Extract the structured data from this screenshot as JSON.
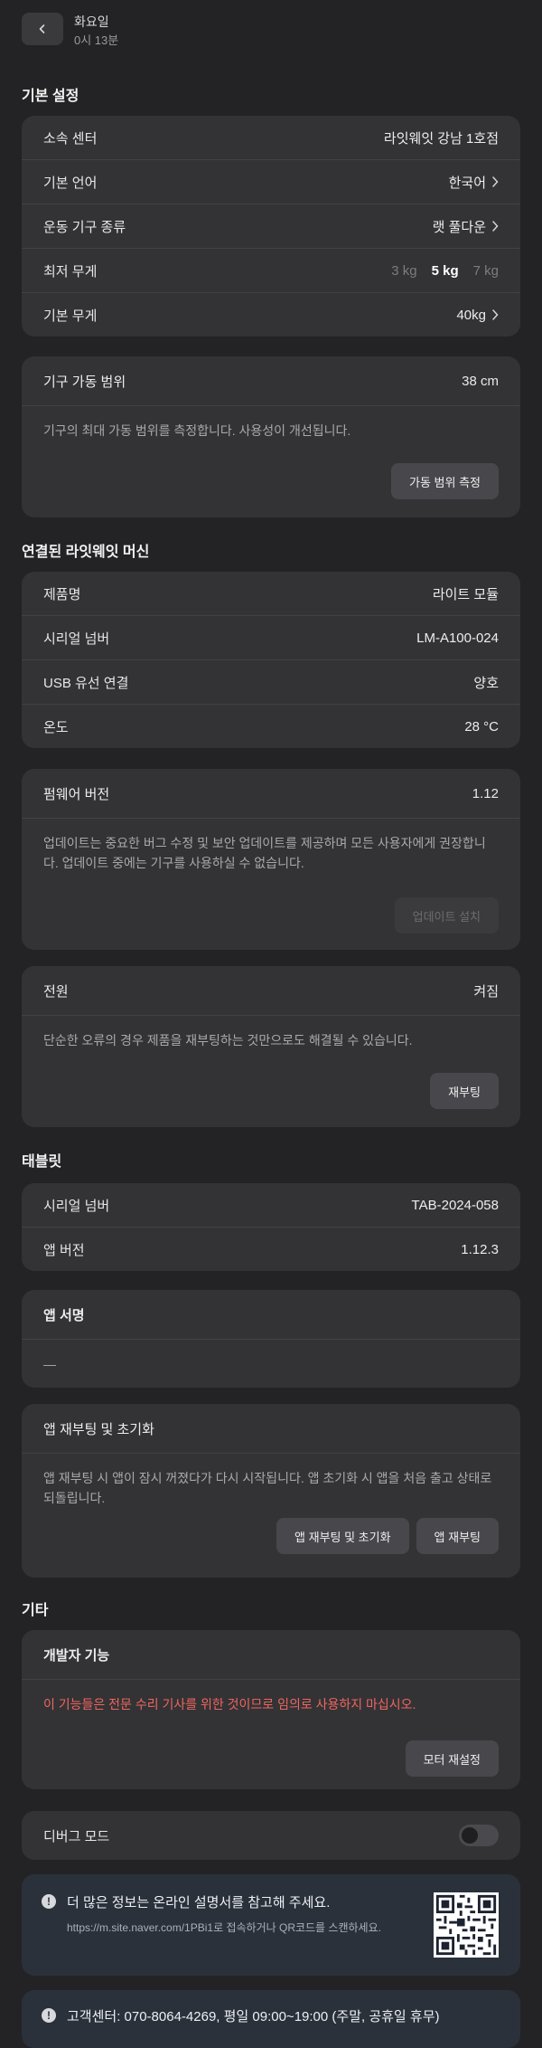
{
  "header": {
    "title": "화요일",
    "subtitle": "0시 13분",
    "back_icon": "chevron-left-icon"
  },
  "basic": {
    "title": "기본 설정",
    "rows": [
      {
        "label": "소속 센터",
        "value": "라잇웨잇 강남 1호점"
      },
      {
        "label": "기본 언어",
        "value": "한국어"
      },
      {
        "label": "운동 기구 종류",
        "value": "랫 풀다운"
      },
      {
        "label": "최저 무게",
        "options": [
          "3 kg",
          "5 kg",
          "7 kg"
        ],
        "selected": "5 kg"
      },
      {
        "label": "기본 무게",
        "value": "40kg"
      }
    ]
  },
  "range": {
    "label": "기구 가동 범위",
    "value": "38 cm",
    "desc": "기구의 최대 가동 범위를 측정합니다. 사용성이 개선됩니다.",
    "button": "가동 범위 측정"
  },
  "machine": {
    "title": "연결된 라잇웨잇 머신",
    "rows": [
      {
        "label": "제품명",
        "value": "라이트 모듈"
      },
      {
        "label": "시리얼 넘버",
        "value": "LM-A100-024"
      },
      {
        "label": "USB 유선 연결",
        "value": "양호"
      },
      {
        "label": "온도",
        "value": "28 °C"
      }
    ]
  },
  "firmware": {
    "label": "펌웨어 버전",
    "value": "1.12",
    "desc": "업데이트는 중요한 버그 수정 및 보안 업데이트를 제공하며 모든 사용자에게 권장합니다. 업데이트 중에는 기구를 사용하실 수 없습니다.",
    "button": "업데이트 설치"
  },
  "power": {
    "label": "전원",
    "value": "켜짐",
    "desc": "단순한 오류의 경우 제품을 재부팅하는 것만으로도 해결될 수 있습니다.",
    "button": "재부팅"
  },
  "tablet": {
    "title": "태블릿",
    "rows": [
      {
        "label": "시리얼 넘버",
        "value": "TAB-2024-058"
      },
      {
        "label": "앱 버전",
        "value": "1.12.3"
      }
    ]
  },
  "signature": {
    "label": "앱 서명",
    "value": "—"
  },
  "app_reset": {
    "label": "앱 재부팅 및 초기화",
    "desc": "앱 재부팅 시 앱이 잠시 꺼졌다가 다시 시작됩니다. 앱 초기화 시 앱을 처음 출고 상태로 되돌립니다.",
    "button_reset": "앱 재부팅 및 초기화",
    "button_reboot": "앱 재부팅"
  },
  "etc": {
    "title": "기타"
  },
  "developer": {
    "label": "개발자 기능",
    "warning": "이 기능들은 전문 수리 기사를 위한 것이므로 임의로 사용하지 마십시오.",
    "button": "모터 재설정"
  },
  "debug": {
    "label": "디버그 모드",
    "enabled": false
  },
  "manual": {
    "title": "더 많은 정보는 온라인 설명서를 참고해 주세요.",
    "desc": "https://m.site.naver.com/1PBi1로 접속하거나 QR코드를 스캔하세요.",
    "icon": "info-icon"
  },
  "support": {
    "text": "고객센터: 070-8064-4269, 평일 09:00~19:00 (주말, 공휴일 휴무)",
    "icon": "info-icon"
  },
  "colors": {
    "background": "#232325",
    "card": "#333336",
    "warning": "#f0655e",
    "info_card": "#2a313b"
  }
}
